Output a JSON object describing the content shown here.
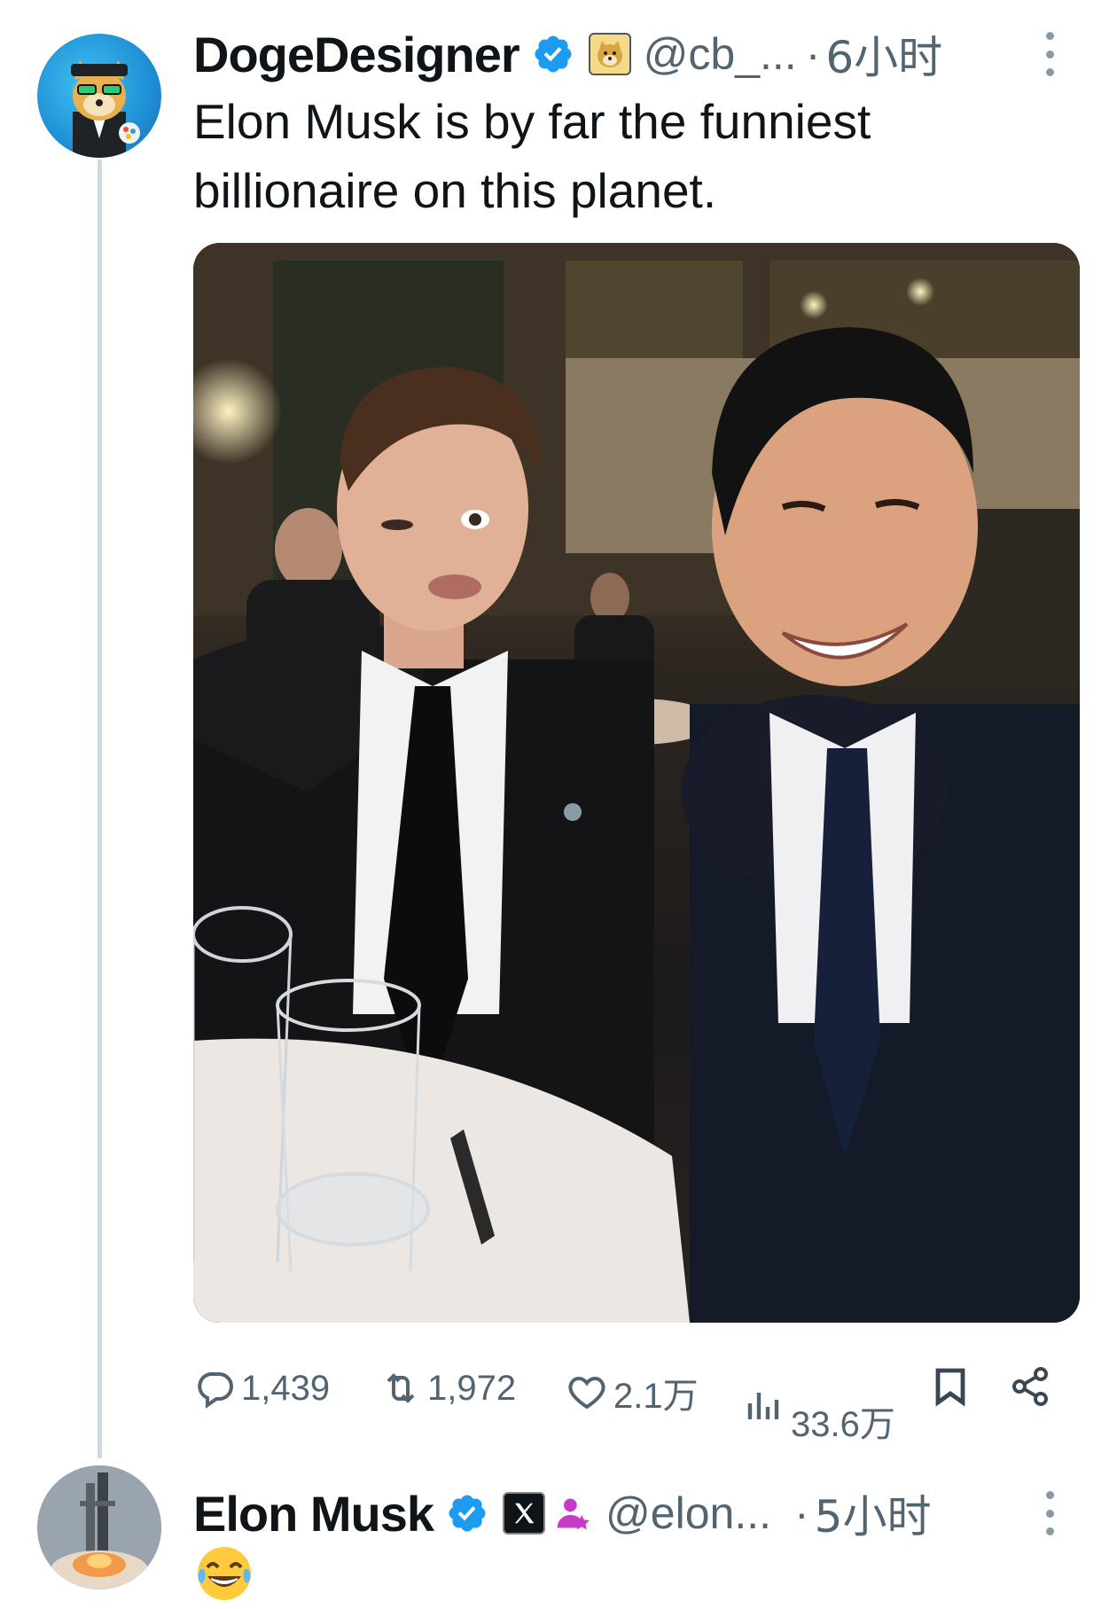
{
  "tweets": [
    {
      "display_name": "DogeDesigner",
      "handle": "@cb_...",
      "separator": "·",
      "time": "6小时",
      "text_line1": "Elon Musk is by far the funniest",
      "text_line2": "billionaire on this planet.",
      "stats": {
        "replies": "1,439",
        "reposts": "1,972",
        "likes": "2.1万",
        "views": "33.6万"
      }
    },
    {
      "display_name": "Elon Musk",
      "handle": "@elon...",
      "separator": "·",
      "time": "5小时",
      "text": "😂"
    }
  ],
  "colors": {
    "verified": "#1d9bf0",
    "secondary_text": "#536471",
    "thread_line": "#cfd9de"
  },
  "icons": [
    "verified-badge-icon",
    "doge-affiliate-icon",
    "x-affiliate-icon",
    "person-badge-icon",
    "more-icon",
    "reply-icon",
    "repost-icon",
    "like-icon",
    "views-icon",
    "bookmark-icon",
    "share-icon"
  ]
}
